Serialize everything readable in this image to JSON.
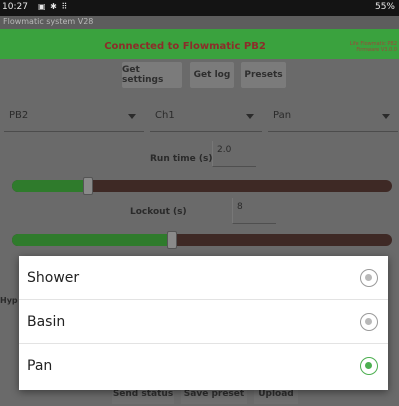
{
  "status_bar": {
    "time": "10:27",
    "icons": "▣ ✱ ⠿",
    "battery": "55%"
  },
  "app": {
    "title": "Flowmatic system V28"
  },
  "connection": {
    "text": "Connected to Flowmatic PB2",
    "mini_text_1": "Life Flowmatic PB2",
    "mini_text_2": "Firmware V3.0.0"
  },
  "buttons": {
    "get_settings": "Get settings",
    "get_log": "Get log",
    "presets": "Presets"
  },
  "spinners": {
    "device": "PB2",
    "channel": "Ch1",
    "fixture": "Pan"
  },
  "run_time": {
    "label": "Run time (s)",
    "value": "2.0",
    "level": 0.2
  },
  "lockout": {
    "label": "Lockout (s)",
    "value": "8",
    "level": 0.42
  },
  "partial_label": "Hyp",
  "dialog": {
    "options": [
      {
        "label": "Shower",
        "selected": false
      },
      {
        "label": "Basin",
        "selected": false
      },
      {
        "label": "Pan",
        "selected": true
      }
    ]
  },
  "bottom_buttons": {
    "send_status": "Send status",
    "save_preset": "Save preset",
    "upload": "Upload"
  },
  "colors": {
    "accent_green": "#4caf50",
    "connection_bar": "#3aa23e"
  }
}
